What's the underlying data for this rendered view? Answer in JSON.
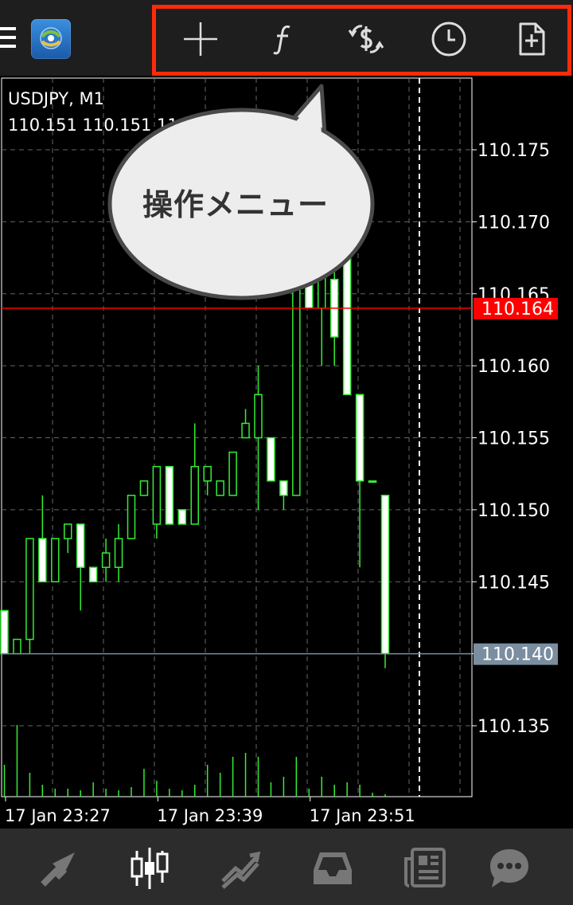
{
  "toolbar": {
    "icons": [
      "crosshair-icon",
      "function-icon",
      "trade-icon",
      "clock-icon",
      "add-file-icon"
    ],
    "highlight_color": "#ff2a0a"
  },
  "chart_header": {
    "symbol": "USDJPY, M1",
    "ohlc": "110.151 110.151 110"
  },
  "callout": {
    "text": "操作メニュー"
  },
  "chart_data": {
    "type": "candlestick",
    "symbol": "USDJPY",
    "timeframe": "M1",
    "ylim": [
      110.13,
      110.18
    ],
    "yticks": [
      "110.175",
      "110.170",
      "110.165",
      "110.160",
      "110.155",
      "110.150",
      "110.145",
      "110.140",
      "110.135"
    ],
    "ytick_values": [
      110.175,
      110.17,
      110.165,
      110.16,
      110.155,
      110.15,
      110.145,
      110.14,
      110.135
    ],
    "xticks": [
      "17 Jan 23:27",
      "17 Jan 23:39",
      "17 Jan 23:51"
    ],
    "xtick_index": [
      1,
      13,
      25
    ],
    "bid": {
      "label": "110.164",
      "value": 110.164,
      "color": "#ff0000"
    },
    "ask": {
      "label": "110.140",
      "value": 110.14,
      "color": "#7a8ea0"
    },
    "candle_color": "#33ee33",
    "candles": [
      {
        "o": 110.143,
        "h": 110.143,
        "l": 110.14,
        "c": 110.14
      },
      {
        "o": 110.14,
        "h": 110.141,
        "l": 110.14,
        "c": 110.141
      },
      {
        "o": 110.141,
        "h": 110.148,
        "l": 110.14,
        "c": 110.148
      },
      {
        "o": 110.148,
        "h": 110.151,
        "l": 110.145,
        "c": 110.145
      },
      {
        "o": 110.145,
        "h": 110.148,
        "l": 110.145,
        "c": 110.148
      },
      {
        "o": 110.148,
        "h": 110.149,
        "l": 110.147,
        "c": 110.149
      },
      {
        "o": 110.149,
        "h": 110.149,
        "l": 110.143,
        "c": 110.146
      },
      {
        "o": 110.146,
        "h": 110.146,
        "l": 110.145,
        "c": 110.145
      },
      {
        "o": 110.146,
        "h": 110.148,
        "l": 110.145,
        "c": 110.147
      },
      {
        "o": 110.146,
        "h": 110.149,
        "l": 110.145,
        "c": 110.148
      },
      {
        "o": 110.148,
        "h": 110.151,
        "l": 110.148,
        "c": 110.151
      },
      {
        "o": 110.151,
        "h": 110.152,
        "l": 110.151,
        "c": 110.152
      },
      {
        "o": 110.149,
        "h": 110.153,
        "l": 110.148,
        "c": 110.153
      },
      {
        "o": 110.153,
        "h": 110.153,
        "l": 110.149,
        "c": 110.149
      },
      {
        "o": 110.15,
        "h": 110.15,
        "l": 110.149,
        "c": 110.149
      },
      {
        "o": 110.149,
        "h": 110.156,
        "l": 110.149,
        "c": 110.153
      },
      {
        "o": 110.152,
        "h": 110.153,
        "l": 110.151,
        "c": 110.153
      },
      {
        "o": 110.151,
        "h": 110.152,
        "l": 110.151,
        "c": 110.152
      },
      {
        "o": 110.151,
        "h": 110.154,
        "l": 110.151,
        "c": 110.154
      },
      {
        "o": 110.155,
        "h": 110.157,
        "l": 110.155,
        "c": 110.156
      },
      {
        "o": 110.155,
        "h": 110.16,
        "l": 110.15,
        "c": 110.158
      },
      {
        "o": 110.155,
        "h": 110.155,
        "l": 110.152,
        "c": 110.152
      },
      {
        "o": 110.152,
        "h": 110.152,
        "l": 110.15,
        "c": 110.151
      },
      {
        "o": 110.151,
        "h": 110.17,
        "l": 110.151,
        "c": 110.17
      },
      {
        "o": 110.168,
        "h": 110.17,
        "l": 110.164,
        "c": 110.164
      },
      {
        "o": 110.164,
        "h": 110.172,
        "l": 110.16,
        "c": 110.168
      },
      {
        "o": 110.166,
        "h": 110.17,
        "l": 110.16,
        "c": 110.162
      },
      {
        "o": 110.169,
        "h": 110.172,
        "l": 110.158,
        "c": 110.158
      },
      {
        "o": 110.158,
        "h": 110.158,
        "l": 110.146,
        "c": 110.152
      },
      {
        "o": 110.152,
        "h": 110.152,
        "l": 110.152,
        "c": 110.152
      },
      {
        "o": 110.151,
        "h": 110.151,
        "l": 110.139,
        "c": 110.14
      }
    ],
    "volumes": [
      40,
      90,
      30,
      15,
      10,
      10,
      8,
      18,
      10,
      8,
      12,
      35,
      20,
      10,
      8,
      15,
      40,
      30,
      50,
      55,
      50,
      18,
      25,
      50,
      10,
      25,
      15,
      18,
      15,
      5,
      3
    ]
  },
  "bottom_nav": {
    "icons": [
      "quotes-icon",
      "chart-icon",
      "trade-icon",
      "history-icon",
      "news-icon",
      "chat-icon"
    ],
    "active": "chart-icon"
  }
}
